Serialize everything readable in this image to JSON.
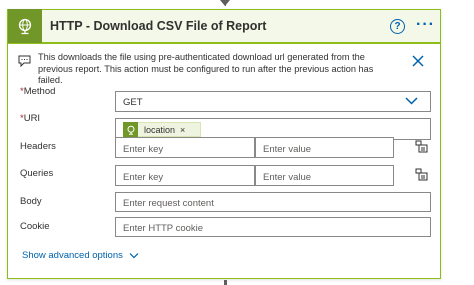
{
  "header": {
    "title": "HTTP - Download CSV File of Report",
    "help_label": "?",
    "more_label": "···",
    "accent_color": "#8cbd18",
    "icon_bg_color": "#709727",
    "icon": "globe-icon"
  },
  "info": {
    "text": "This downloads the file using pre-authenticated download url generated from the previous report. This action must be configured to run after the previous action has failed.",
    "icon": "comment-icon",
    "close_icon": "close-icon"
  },
  "fields": {
    "method": {
      "label": "Method",
      "required_mark": "*",
      "value": "GET"
    },
    "uri": {
      "label": "URI",
      "required_mark": "*",
      "token_label": "location",
      "token_remove": "×"
    },
    "headers": {
      "label": "Headers",
      "key_placeholder": "Enter key",
      "value_placeholder": "Enter value"
    },
    "queries": {
      "label": "Queries",
      "key_placeholder": "Enter key",
      "value_placeholder": "Enter value"
    },
    "body": {
      "label": "Body",
      "placeholder": "Enter request content"
    },
    "cookie": {
      "label": "Cookie",
      "placeholder": "Enter HTTP cookie"
    }
  },
  "advanced": {
    "label": "Show advanced options"
  },
  "colors": {
    "link": "#0062ad",
    "required": "#a4262c"
  }
}
